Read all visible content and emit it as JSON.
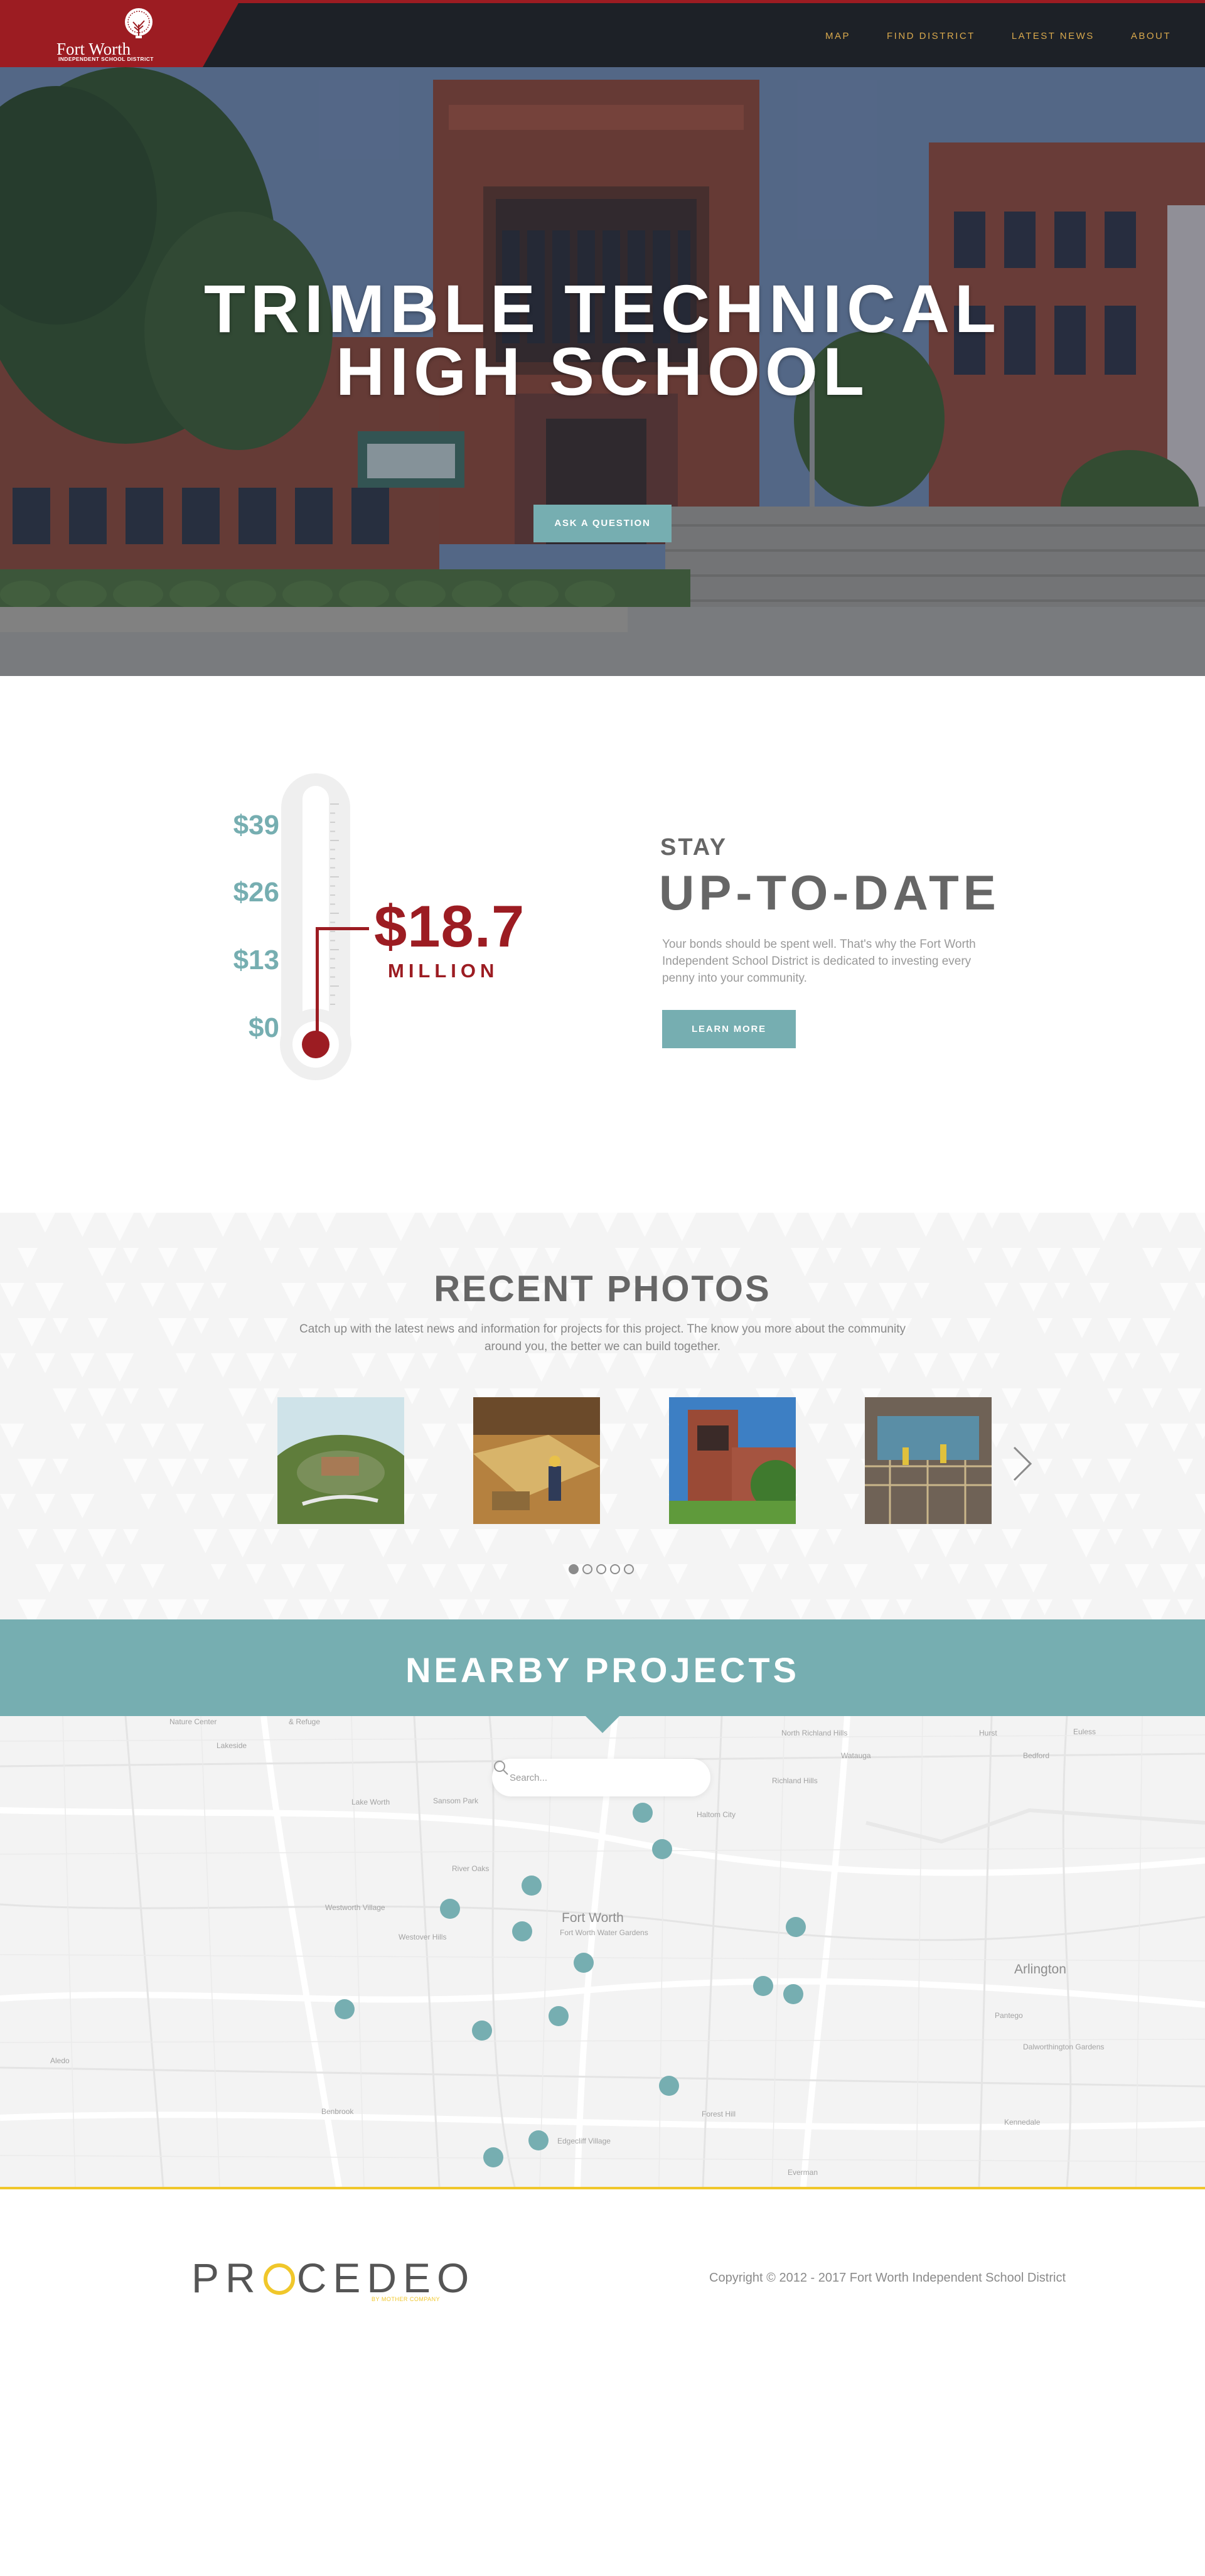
{
  "header": {
    "logo_name": "Fort Worth",
    "logo_sub": "INDEPENDENT SCHOOL DISTRICT",
    "nav": [
      "MAP",
      "FIND DISTRICT",
      "LATEST NEWS",
      "ABOUT"
    ]
  },
  "hero": {
    "title_line1": "TRIMBLE TECHNICAL",
    "title_line2": "HIGH SCHOOL",
    "button": "ASK A QUESTION"
  },
  "fund": {
    "scale": [
      "$39",
      "$26",
      "$13",
      "$0"
    ],
    "amount": "$18.7",
    "amount_unit": "MILLION",
    "fill_fraction": 0.48,
    "kicker": "STAY",
    "headline": "UP-TO-DATE",
    "text": "Your bonds should be spent well. That's why the Fort Worth Independent School District is dedicated to investing every penny into your community.",
    "button": "LEARN MORE"
  },
  "photos": {
    "title": "RECENT PHOTOS",
    "text": "Catch up with the latest news and information for projects for this project. The know you more about the community around you, the better we can build together.",
    "thumbs": [
      "aerial-campus-photo",
      "construction-workers-photo",
      "school-building-photo",
      "construction-site-photo"
    ],
    "active_page": 1,
    "page_count": 5
  },
  "nearby": {
    "title": "NEARBY PROJECTS",
    "search_placeholder": "Search...",
    "map_labels": {
      "city": "Fort Worth",
      "water_gardens": "Fort Worth Water Gardens",
      "arlington": "Arlington",
      "lake_worth": "Lake Worth",
      "haltom": "Haltom City",
      "richland": "North Richland Hills",
      "westworth": "Westworth Village",
      "benbrook": "Benbrook",
      "edgecliff": "Edgecliff Village",
      "forest_hill": "Forest Hill",
      "everman": "Everman",
      "euless": "Euless",
      "river_oaks": "River Oaks",
      "sansom": "Sansom Park",
      "lakeside": "Lakeside",
      "pantego": "Pantego",
      "dalworth": "Dalworthington Gardens",
      "kennedale": "Kennedale",
      "aledo": "Aledo",
      "hurst": "Hurst",
      "bedford": "Bedford",
      "watauga": "Watauga",
      "richland_hills": "Richland Hills",
      "westover": "Westover Hills",
      "saginaw": "& Refuge",
      "nature": "Nature Center"
    }
  },
  "footer": {
    "brand_left": "PR",
    "brand_right": "CEDEO",
    "brand_sub": "BY MOTHER COMPANY",
    "copyright": "Copyright © 2012 - 2017 Fort Worth Independent School District"
  }
}
